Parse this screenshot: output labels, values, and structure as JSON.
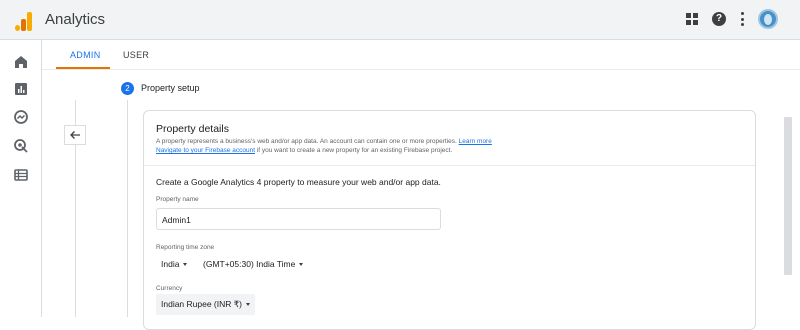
{
  "app": {
    "title": "Analytics",
    "icons": [
      "analytics-logo",
      "apps-grid-icon",
      "help-icon",
      "more-vert-icon",
      "account-avatar"
    ]
  },
  "rail": {
    "items": [
      {
        "name": "home-icon"
      },
      {
        "name": "reports-icon"
      },
      {
        "name": "explore-icon"
      },
      {
        "name": "advertising-icon"
      },
      {
        "name": "configure-icon"
      }
    ]
  },
  "tabs": [
    {
      "label": "ADMIN",
      "active": true
    },
    {
      "label": "USER",
      "active": false
    }
  ],
  "step": {
    "number": "2",
    "title": "Property setup"
  },
  "card": {
    "title": "Property details",
    "desc_text": "A property represents a business's web and/or app data. An account can contain one or more properties. ",
    "learn_more": "Learn more",
    "firebase_link": "Navigate to your Firebase account",
    "desc_text2": " if you want to create a new property for an existing Firebase project.",
    "intro": "Create a Google Analytics 4 property to measure your web and/or app data.",
    "property_name_label": "Property name",
    "property_name_value": "Admin1",
    "timezone_label": "Reporting time zone",
    "country_value": "India",
    "timezone_value": "(GMT+05:30) India Time",
    "currency_label": "Currency",
    "currency_value": "Indian Rupee (INR ₹)"
  },
  "colors": {
    "accent": "#1a73e8",
    "orange": "#e37400",
    "topbar_bg": "#f1f3f4"
  }
}
